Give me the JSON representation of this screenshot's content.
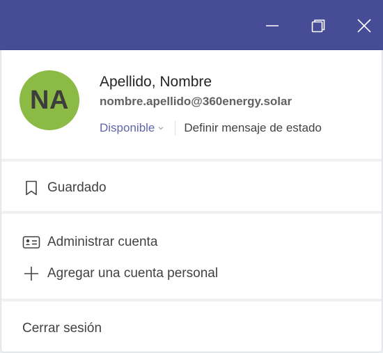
{
  "window": {
    "controls": {
      "minimize": "minimize-icon",
      "restore": "restore-icon",
      "close": "close-icon"
    },
    "titlebar_color": "#464c95"
  },
  "profile": {
    "initials": "NA",
    "avatar_color": "#8cbb45",
    "name": "Apellido, Nombre",
    "email": "nombre.apellido@360energy.solar",
    "status": "Disponible",
    "status_color": "#6264a7",
    "set_status_label": "Definir mensaje de estado"
  },
  "menu": {
    "saved": "Guardado",
    "manage_account": "Administrar cuenta",
    "add_personal_account": "Agregar una cuenta personal",
    "sign_out": "Cerrar sesión"
  }
}
